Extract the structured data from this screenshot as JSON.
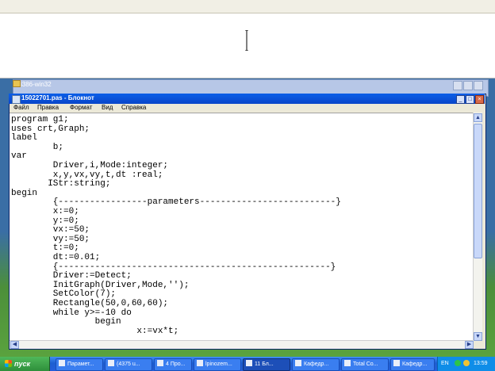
{
  "background_window": {
    "title": "i386-win32"
  },
  "notepad": {
    "title": "15022701.pas - Блокнот",
    "menu": [
      "Файл",
      "Правка",
      "Формат",
      "Вид",
      "Справка"
    ],
    "code_lines": [
      "program g1;",
      "uses crt,Graph;",
      "label",
      "        b;",
      "var",
      "        Driver,i,Mode:integer;",
      "        x,y,vx,vy,t,dt :real;",
      "       IStr:string;",
      "begin",
      "        {-----------------parameters--------------------------}",
      "        x:=0;",
      "        y:=0;",
      "        vx:=50;",
      "        vy:=50;",
      "        t:=0;",
      "        dt:=0.01;",
      "        {----------------------------------------------------}",
      "        Driver:=Detect;",
      "        InitGraph(Driver,Mode,'');",
      "        SetColor(7);",
      "        Rectangle(50,0,60,60);",
      "        while y>=-10 do",
      "                begin",
      "                        x:=vx*t;"
    ]
  },
  "taskbar": {
    "start_label": "пуск",
    "items": [
      "Парамет...",
      "(4375 u...",
      "4 Про...",
      "lpinozem...",
      "11 Бл...",
      "Кафедр...",
      "Total Co...",
      "Кафедр..."
    ],
    "active_index": 4,
    "language": "EN",
    "clock": "13:59"
  },
  "colors": {
    "taskbar_blue": "#245edb",
    "start_green": "#2e8f3b",
    "titlebar_blue": "#0946c9",
    "tray_blue": "#0f8de8"
  }
}
